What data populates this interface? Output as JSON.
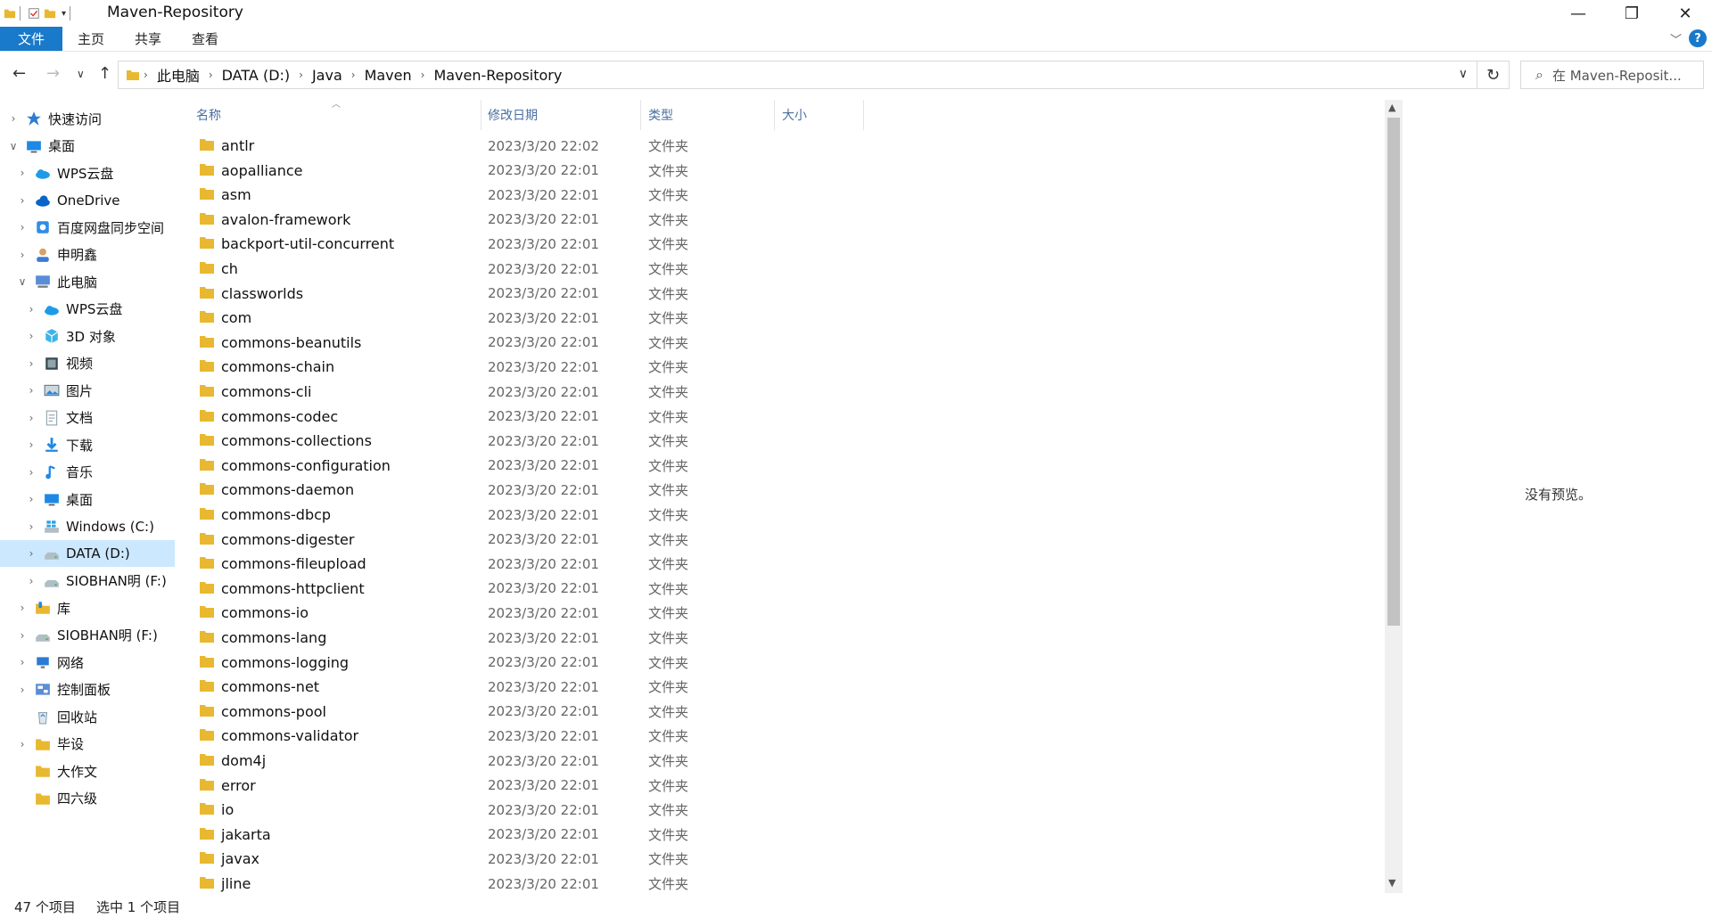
{
  "window": {
    "title": "Maven-Repository"
  },
  "ribbon": {
    "tabs": [
      {
        "label": "文件"
      },
      {
        "label": "主页"
      },
      {
        "label": "共享"
      },
      {
        "label": "查看"
      }
    ]
  },
  "address": {
    "crumbs": [
      "此电脑",
      "DATA (D:)",
      "Java",
      "Maven",
      "Maven-Repository"
    ]
  },
  "search": {
    "placeholder": "在 Maven-Reposit..."
  },
  "tree": {
    "items": [
      {
        "label": "快速访问",
        "icon": "star-icon",
        "indent": 0,
        "exp": ">"
      },
      {
        "label": "桌面",
        "icon": "desktop-icon",
        "indent": 0,
        "exp": "v"
      },
      {
        "label": "WPS云盘",
        "icon": "cloud-icon",
        "indent": 1,
        "exp": ">"
      },
      {
        "label": "OneDrive",
        "icon": "onedrive-icon",
        "indent": 1,
        "exp": ">"
      },
      {
        "label": "百度网盘同步空间",
        "icon": "baidu-icon",
        "indent": 1,
        "exp": ">"
      },
      {
        "label": "申明鑫",
        "icon": "user-icon",
        "indent": 1,
        "exp": ">"
      },
      {
        "label": "此电脑",
        "icon": "computer-icon",
        "indent": 1,
        "exp": "v"
      },
      {
        "label": "WPS云盘",
        "icon": "cloud-icon",
        "indent": 2,
        "exp": ">"
      },
      {
        "label": "3D 对象",
        "icon": "cube-icon",
        "indent": 2,
        "exp": ">"
      },
      {
        "label": "视频",
        "icon": "video-icon",
        "indent": 2,
        "exp": ">"
      },
      {
        "label": "图片",
        "icon": "picture-icon",
        "indent": 2,
        "exp": ">"
      },
      {
        "label": "文档",
        "icon": "document-icon",
        "indent": 2,
        "exp": ">"
      },
      {
        "label": "下载",
        "icon": "download-icon",
        "indent": 2,
        "exp": ">"
      },
      {
        "label": "音乐",
        "icon": "music-icon",
        "indent": 2,
        "exp": ">"
      },
      {
        "label": "桌面",
        "icon": "desktop-icon",
        "indent": 2,
        "exp": ">"
      },
      {
        "label": "Windows (C:)",
        "icon": "windows-drive-icon",
        "indent": 2,
        "exp": ">"
      },
      {
        "label": "DATA (D:)",
        "icon": "drive-icon",
        "indent": 2,
        "exp": ">",
        "selected": true
      },
      {
        "label": "SIOBHAN明 (F:)",
        "icon": "drive-icon",
        "indent": 2,
        "exp": ">"
      },
      {
        "label": "库",
        "icon": "library-icon",
        "indent": 1,
        "exp": ">"
      },
      {
        "label": "SIOBHAN明 (F:)",
        "icon": "drive-icon",
        "indent": 1,
        "exp": ">"
      },
      {
        "label": "网络",
        "icon": "network-icon",
        "indent": 1,
        "exp": ">"
      },
      {
        "label": "控制面板",
        "icon": "control-panel-icon",
        "indent": 1,
        "exp": ">"
      },
      {
        "label": "回收站",
        "icon": "recycle-bin-icon",
        "indent": 1,
        "exp": ""
      },
      {
        "label": "毕设",
        "icon": "folder-icon",
        "indent": 1,
        "exp": ">"
      },
      {
        "label": "大作文",
        "icon": "folder-icon",
        "indent": 1,
        "exp": ""
      },
      {
        "label": "四六级",
        "icon": "folder-icon",
        "indent": 1,
        "exp": ""
      }
    ]
  },
  "columns": {
    "name": "名称",
    "date": "修改日期",
    "type": "类型",
    "size": "大小"
  },
  "files": [
    {
      "name": "antlr",
      "date": "2023/3/20 22:02",
      "type": "文件夹"
    },
    {
      "name": "aopalliance",
      "date": "2023/3/20 22:01",
      "type": "文件夹"
    },
    {
      "name": "asm",
      "date": "2023/3/20 22:01",
      "type": "文件夹"
    },
    {
      "name": "avalon-framework",
      "date": "2023/3/20 22:01",
      "type": "文件夹"
    },
    {
      "name": "backport-util-concurrent",
      "date": "2023/3/20 22:01",
      "type": "文件夹"
    },
    {
      "name": "ch",
      "date": "2023/3/20 22:01",
      "type": "文件夹"
    },
    {
      "name": "classworlds",
      "date": "2023/3/20 22:01",
      "type": "文件夹"
    },
    {
      "name": "com",
      "date": "2023/3/20 22:01",
      "type": "文件夹"
    },
    {
      "name": "commons-beanutils",
      "date": "2023/3/20 22:01",
      "type": "文件夹"
    },
    {
      "name": "commons-chain",
      "date": "2023/3/20 22:01",
      "type": "文件夹"
    },
    {
      "name": "commons-cli",
      "date": "2023/3/20 22:01",
      "type": "文件夹"
    },
    {
      "name": "commons-codec",
      "date": "2023/3/20 22:01",
      "type": "文件夹"
    },
    {
      "name": "commons-collections",
      "date": "2023/3/20 22:01",
      "type": "文件夹"
    },
    {
      "name": "commons-configuration",
      "date": "2023/3/20 22:01",
      "type": "文件夹"
    },
    {
      "name": "commons-daemon",
      "date": "2023/3/20 22:01",
      "type": "文件夹"
    },
    {
      "name": "commons-dbcp",
      "date": "2023/3/20 22:01",
      "type": "文件夹"
    },
    {
      "name": "commons-digester",
      "date": "2023/3/20 22:01",
      "type": "文件夹"
    },
    {
      "name": "commons-fileupload",
      "date": "2023/3/20 22:01",
      "type": "文件夹"
    },
    {
      "name": "commons-httpclient",
      "date": "2023/3/20 22:01",
      "type": "文件夹"
    },
    {
      "name": "commons-io",
      "date": "2023/3/20 22:01",
      "type": "文件夹"
    },
    {
      "name": "commons-lang",
      "date": "2023/3/20 22:01",
      "type": "文件夹"
    },
    {
      "name": "commons-logging",
      "date": "2023/3/20 22:01",
      "type": "文件夹"
    },
    {
      "name": "commons-net",
      "date": "2023/3/20 22:01",
      "type": "文件夹"
    },
    {
      "name": "commons-pool",
      "date": "2023/3/20 22:01",
      "type": "文件夹"
    },
    {
      "name": "commons-validator",
      "date": "2023/3/20 22:01",
      "type": "文件夹"
    },
    {
      "name": "dom4j",
      "date": "2023/3/20 22:01",
      "type": "文件夹"
    },
    {
      "name": "error",
      "date": "2023/3/20 22:01",
      "type": "文件夹"
    },
    {
      "name": "io",
      "date": "2023/3/20 22:01",
      "type": "文件夹"
    },
    {
      "name": "jakarta",
      "date": "2023/3/20 22:01",
      "type": "文件夹"
    },
    {
      "name": "javax",
      "date": "2023/3/20 22:01",
      "type": "文件夹"
    },
    {
      "name": "jline",
      "date": "2023/3/20 22:01",
      "type": "文件夹"
    }
  ],
  "preview": {
    "text": "没有预览。"
  },
  "status": {
    "count": "47 个项目",
    "selected": "选中 1 个项目"
  },
  "colors": {
    "accent": "#1979ca",
    "selection": "#cce8ff",
    "folder": "#e8b830"
  }
}
